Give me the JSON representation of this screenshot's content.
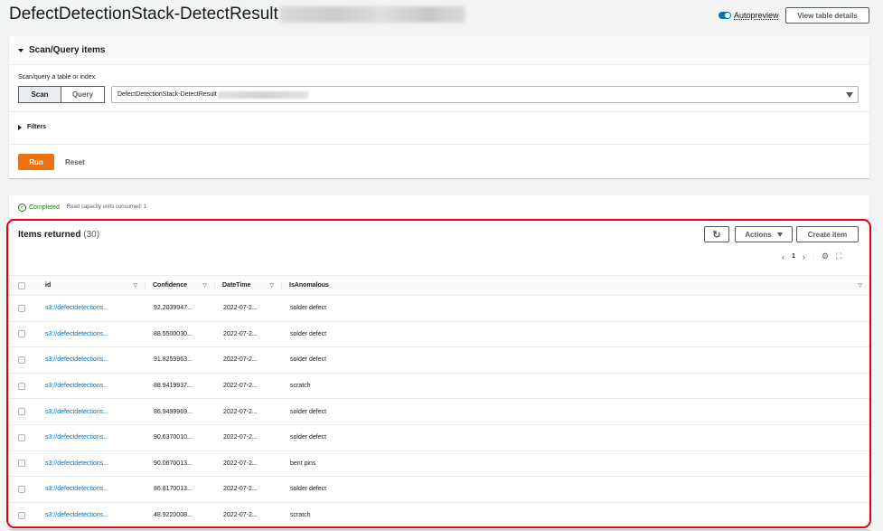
{
  "header": {
    "title": "DefectDetectionStack-DetectResult",
    "autopreview_label": "Autopreview",
    "view_table_details": "View table details"
  },
  "scan_panel": {
    "title": "Scan/Query items",
    "scan_label": "Scan/query a table or index",
    "scan_button": "Scan",
    "query_button": "Query",
    "selected_table": "DefectDetectionStack-DetectResult",
    "filters_label": "Filters",
    "run_button": "Run",
    "reset_button": "Reset"
  },
  "status": {
    "completed": "Completed",
    "capacity": "Read capacity units consumed: 1"
  },
  "items": {
    "title": "Items returned",
    "count": "(30)",
    "actions_button": "Actions",
    "create_button": "Create item",
    "page_number": "1",
    "columns": [
      "id",
      "Confidence",
      "DateTime",
      "IsAnomalous"
    ],
    "rows": [
      {
        "id": "s3://defectdetections...",
        "confidence": "92.2039947...",
        "datetime": "2022-07-2...",
        "anomalous": "solder defect"
      },
      {
        "id": "s3://defectdetections...",
        "confidence": "88.5500030...",
        "datetime": "2022-07-2...",
        "anomalous": "solder defect"
      },
      {
        "id": "s3://defectdetections...",
        "confidence": "91.8259963...",
        "datetime": "2022-07-2...",
        "anomalous": "solder defect"
      },
      {
        "id": "s3://defectdetections...",
        "confidence": "88.9419937...",
        "datetime": "2022-07-2...",
        "anomalous": "scratch"
      },
      {
        "id": "s3://defectdetections...",
        "confidence": "86.9499969...",
        "datetime": "2022-07-2...",
        "anomalous": "solder defect"
      },
      {
        "id": "s3://defectdetections...",
        "confidence": "90.6370010...",
        "datetime": "2022-07-2...",
        "anomalous": "solder defect"
      },
      {
        "id": "s3://defectdetections...",
        "confidence": "90.0670013...",
        "datetime": "2022-07-2...",
        "anomalous": "bent pins"
      },
      {
        "id": "s3://defectdetections...",
        "confidence": "86.8170013...",
        "datetime": "2022-07-2...",
        "anomalous": "solder defect"
      },
      {
        "id": "s3://defectdetections...",
        "confidence": "48.9220008...",
        "datetime": "2022-07-2...",
        "anomalous": "scratch"
      }
    ]
  },
  "colors": {
    "primary": "#ec7211",
    "link": "#0073bb",
    "success": "#1d8102",
    "highlight": "#e8000e"
  }
}
